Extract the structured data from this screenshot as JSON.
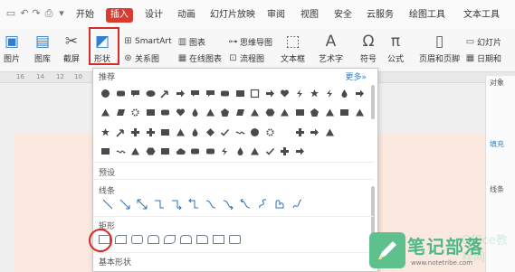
{
  "menu": {
    "items": [
      "开始",
      "插入",
      "设计",
      "动画",
      "幻灯片放映",
      "审阅",
      "视图",
      "安全",
      "云服务",
      "绘图工具",
      "文本工具"
    ],
    "active_index": 1
  },
  "ribbon": {
    "picture": "图片",
    "gallery": "图库",
    "screenshot": "截屏",
    "shape": "形状",
    "smartart": "SmartArt",
    "chart": "图表",
    "mindmap": "思维导图",
    "relation": "关系图",
    "online_chart": "在线图表",
    "flowchart": "流程图",
    "textbox": "文本框",
    "wordart": "艺术字",
    "symbol": "符号",
    "formula": "公式",
    "header_footer": "页眉和页脚",
    "slide_no": "幻灯片",
    "datetime": "日期和"
  },
  "ruler": [
    "16",
    "14",
    "12",
    "10",
    "8"
  ],
  "right_pane": {
    "title": "对象",
    "fill": "填充",
    "line": "线条"
  },
  "shape_panel": {
    "recommended": "推荐",
    "more": "更多»",
    "preset": "预设",
    "lines": "线条",
    "rectangles": "矩形",
    "basic": "基本形状"
  },
  "watermark": {
    "brand": "笔记部落",
    "url": "www.notetribe.com",
    "faint": "Office教程网"
  },
  "colors": {
    "accent": "#d83b30",
    "highlight": "#d82b26",
    "watermark": "#5ec18d"
  }
}
